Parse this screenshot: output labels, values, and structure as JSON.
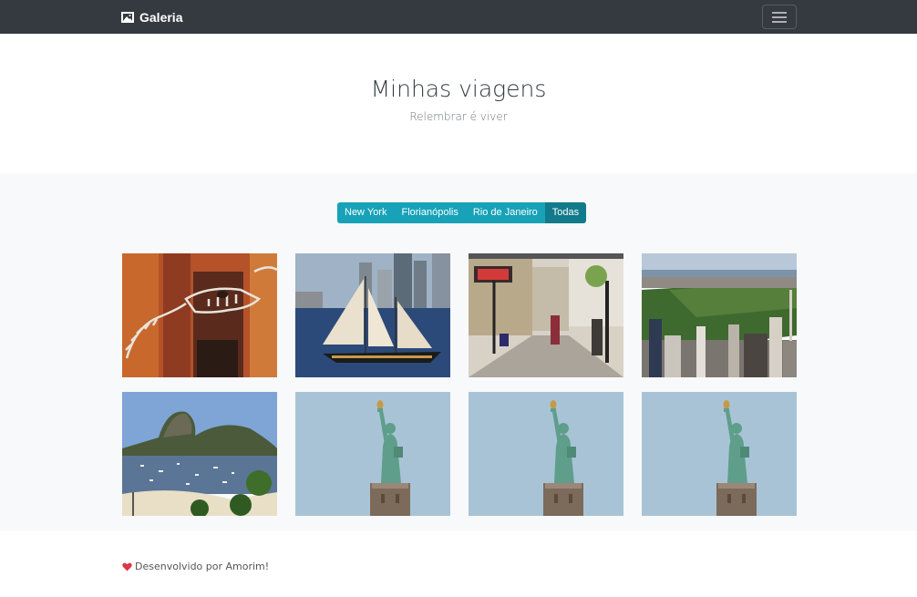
{
  "navbar": {
    "brand": "Galeria",
    "brand_icon": "picture-icon",
    "toggler_icon": "hamburger-menu-icon"
  },
  "hero": {
    "title": "Minhas viagens",
    "subtitle": "Relembrar é viver"
  },
  "filters": [
    {
      "label": "New York",
      "active": false
    },
    {
      "label": "Florianópolis",
      "active": false
    },
    {
      "label": "Rio de Janeiro",
      "active": false
    },
    {
      "label": "Todas",
      "active": true
    }
  ],
  "gallery": [
    {
      "scene": "dinosaur-skeleton"
    },
    {
      "scene": "sailboat"
    },
    {
      "scene": "street"
    },
    {
      "scene": "central-park"
    },
    {
      "scene": "sugarloaf"
    },
    {
      "scene": "statue-of-liberty"
    },
    {
      "scene": "statue-of-liberty"
    },
    {
      "scene": "statue-of-liberty"
    }
  ],
  "footer": {
    "text": "Desenvolvido por Amorim!",
    "icon": "heart-icon"
  },
  "colors": {
    "navbar": "#343a40",
    "filter": "#17a2b8",
    "filter_active": "#117a8b",
    "album_bg": "#f8f9fa",
    "heart": "#dc3545"
  }
}
